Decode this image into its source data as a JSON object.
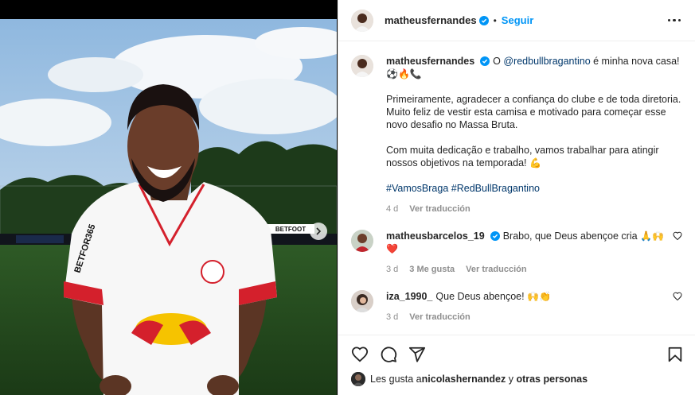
{
  "post": {
    "author": "matheusfernandes",
    "follow_label": "Seguir",
    "separator": "•"
  },
  "caption": {
    "username": "matheusfernandes",
    "prefix": "O ",
    "mention": "@redbullbragantino",
    "line1_rest": " é minha nova casa!",
    "emojis1": "⚽🔥📞",
    "para2": "Primeiramente, agradecer a confiança do clube e de toda diretoria. Muito feliz de vestir esta camisa e motivado para começar esse novo desafio no Massa Bruta.",
    "para3": "Com muita dedicação e trabalho, vamos trabalhar para atingir nossos objetivos na temporada!",
    "emoji3": "💪",
    "hashtag1": "#VamosBraga",
    "hashtag2": "#RedBullBragantino",
    "age": "4 d",
    "translate": "Ver traducción"
  },
  "comments": [
    {
      "username": "matheusbarcelos_19",
      "text": "Brabo, que Deus abençoe cria",
      "emojis": "🙏🙌",
      "emoji2": "❤️",
      "age": "3 d",
      "likes": "3 Me gusta",
      "translate": "Ver traducción"
    },
    {
      "username": "iza_1990_",
      "text": "Que Deus abençoe!",
      "emojis": "🙌👏",
      "age": "3 d",
      "translate": "Ver traducción"
    }
  ],
  "likes_line": {
    "prefix": "Les gusta a ",
    "user": "nicolashernandez",
    "middle": " y ",
    "others": "otras personas"
  },
  "sponsor": {
    "logo_text": "Red Bull",
    "shirt_sponsor": "BETFOR365",
    "board_text": "BETFOOT"
  },
  "icons": {
    "verified": "verified-badge-icon",
    "more": "more-options-icon",
    "heart": "heart-icon",
    "comment": "comment-icon",
    "share": "share-icon",
    "save": "bookmark-icon",
    "next": "chevron-right-icon"
  },
  "colors": {
    "link": "#00376b",
    "accent": "#0095f6",
    "muted": "#8e8e8e",
    "verified": "#0095f6"
  }
}
